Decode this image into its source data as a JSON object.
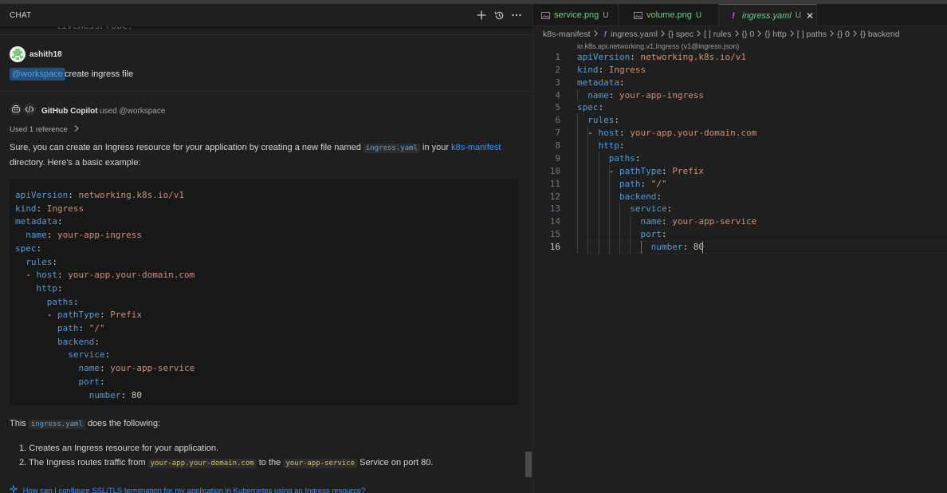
{
  "chat": {
    "title": "CHAT",
    "prev_code_fragment": "livenessProbe:",
    "user": {
      "name": "ashith18",
      "workspace_chip": "@workspace",
      "request_text": "create ingress file"
    },
    "assistant": {
      "name": "GitHub Copilot",
      "used_agent": "used @workspace",
      "references_label": "Used 1 reference",
      "intro_part1": "Sure, you can create an Ingress resource for your application by creating a new file named",
      "intro_chip": "ingress.yaml",
      "intro_part2": "in your",
      "intro_link": "k8s-manifest",
      "intro_part3": "directory. Here's a basic example:",
      "code_lines": [
        {
          "k": "apiVersion",
          "sep": ": ",
          "v": "networking.k8s.io/v1",
          "t": "v",
          "indent": ""
        },
        {
          "k": "kind",
          "sep": ": ",
          "v": "Ingress",
          "t": "v",
          "indent": ""
        },
        {
          "k": "metadata",
          "sep": ":",
          "v": "",
          "t": "v",
          "indent": ""
        },
        {
          "k": "name",
          "sep": ": ",
          "v": "your-app-ingress",
          "t": "v",
          "indent": "  "
        },
        {
          "k": "spec",
          "sep": ":",
          "v": "",
          "t": "v",
          "indent": ""
        },
        {
          "k": "rules",
          "sep": ":",
          "v": "",
          "t": "v",
          "indent": "  "
        },
        {
          "k": "host",
          "sep": ": ",
          "v": "your-app.your-domain.com",
          "t": "v",
          "indent": "  - "
        },
        {
          "k": "http",
          "sep": ":",
          "v": "",
          "t": "v",
          "indent": "    "
        },
        {
          "k": "paths",
          "sep": ":",
          "v": "",
          "t": "v",
          "indent": "      "
        },
        {
          "k": "pathType",
          "sep": ": ",
          "v": "Prefix",
          "t": "v",
          "indent": "      - "
        },
        {
          "k": "path",
          "sep": ": ",
          "v": "\"/\"",
          "t": "v",
          "indent": "        "
        },
        {
          "k": "backend",
          "sep": ":",
          "v": "",
          "t": "v",
          "indent": "        "
        },
        {
          "k": "service",
          "sep": ":",
          "v": "",
          "t": "v",
          "indent": "          "
        },
        {
          "k": "name",
          "sep": ": ",
          "v": "your-app-service",
          "t": "v",
          "indent": "            "
        },
        {
          "k": "port",
          "sep": ":",
          "v": "",
          "t": "v",
          "indent": "            "
        },
        {
          "k": "number",
          "sep": ": ",
          "v": "80",
          "t": "n",
          "indent": "              "
        }
      ],
      "explain_part1": "This",
      "explain_chip": "ingress.yaml",
      "explain_part2": "does the following:",
      "list": [
        {
          "num": "1.",
          "text": "Creates an Ingress resource for your application."
        },
        {
          "num": "2.",
          "a": "The Ingress routes traffic from",
          "chip1": "your-app.your-domain.com",
          "b": "to the",
          "chip2": "your-app-service",
          "c": "Service on port 80."
        }
      ],
      "suggestion": "How can I configure SSL/TLS termination for my application in Kubernetes using an Ingress resource?"
    }
  },
  "editor": {
    "tabs": [
      {
        "name": "service.png",
        "status": "U",
        "icon": "image-icon",
        "active": false
      },
      {
        "name": "volume.png",
        "status": "U",
        "icon": "image-icon",
        "active": false
      },
      {
        "name": "ingress.yaml",
        "status": "U",
        "icon": "yaml-warning-icon",
        "active": true
      }
    ],
    "breadcrumbs": [
      "k8s-manifest",
      "ingress.yaml",
      "{} spec",
      "[ ] rules",
      "{} 0",
      "{} http",
      "[ ] paths",
      "{} 0",
      "{} backend"
    ],
    "schema": "io.k8s.api.networking.v1.Ingress (v1@ingress.json)",
    "current_line": 16,
    "lines": [
      {
        "num": "1",
        "indent": "",
        "k": "apiVersion",
        "sep": ": ",
        "v": "networking.k8s.io/v1",
        "t": "v"
      },
      {
        "num": "2",
        "indent": "",
        "k": "kind",
        "sep": ": ",
        "v": "Ingress",
        "t": "v"
      },
      {
        "num": "3",
        "indent": "",
        "k": "metadata",
        "sep": ":",
        "v": "",
        "t": "v"
      },
      {
        "num": "4",
        "indent": "  ",
        "k": "name",
        "sep": ": ",
        "v": "your-app-ingress",
        "t": "v"
      },
      {
        "num": "5",
        "indent": "",
        "k": "spec",
        "sep": ":",
        "v": "",
        "t": "v"
      },
      {
        "num": "6",
        "indent": "  ",
        "k": "rules",
        "sep": ":",
        "v": "",
        "t": "v"
      },
      {
        "num": "7",
        "indent": "  - ",
        "k": "host",
        "sep": ": ",
        "v": "your-app.your-domain.com",
        "t": "v"
      },
      {
        "num": "8",
        "indent": "    ",
        "k": "http",
        "sep": ":",
        "v": "",
        "t": "v"
      },
      {
        "num": "9",
        "indent": "      ",
        "k": "paths",
        "sep": ":",
        "v": "",
        "t": "v"
      },
      {
        "num": "10",
        "indent": "      - ",
        "k": "pathType",
        "sep": ": ",
        "v": "Prefix",
        "t": "v"
      },
      {
        "num": "11",
        "indent": "        ",
        "k": "path",
        "sep": ": ",
        "v": "\"/\"",
        "t": "v"
      },
      {
        "num": "12",
        "indent": "        ",
        "k": "backend",
        "sep": ":",
        "v": "",
        "t": "v"
      },
      {
        "num": "13",
        "indent": "          ",
        "k": "service",
        "sep": ":",
        "v": "",
        "t": "v"
      },
      {
        "num": "14",
        "indent": "            ",
        "k": "name",
        "sep": ": ",
        "v": "your-app-service",
        "t": "v"
      },
      {
        "num": "15",
        "indent": "            ",
        "k": "port",
        "sep": ":",
        "v": "",
        "t": "v"
      },
      {
        "num": "16",
        "indent": "              ",
        "k": "number",
        "sep": ": ",
        "v": "80",
        "t": "n"
      }
    ]
  },
  "colors": {
    "yaml_key": "#569cd6",
    "yaml_string": "#ce9178",
    "yaml_number": "#b5cea8",
    "untracked": "#73c991",
    "link": "#3794ff",
    "accent": "#0078d4"
  }
}
